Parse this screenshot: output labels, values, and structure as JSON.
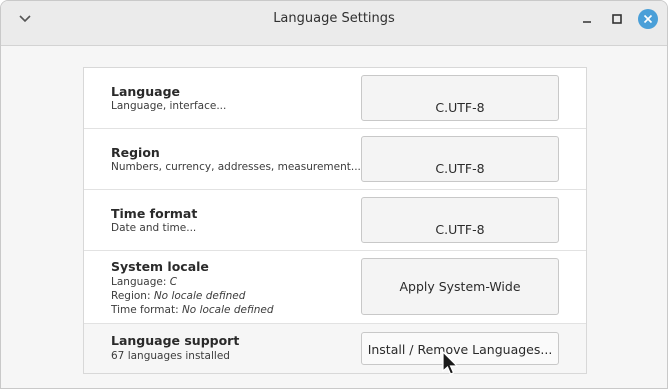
{
  "window": {
    "title": "Language Settings"
  },
  "titlebar_icons": {
    "menu": "chevron-down-icon",
    "minimize": "minimize-icon",
    "maximize": "maximize-icon",
    "close": "close-icon",
    "close_color": "#4a9fd8"
  },
  "rows": [
    {
      "title": "Language",
      "subtitle": "Language, interface...",
      "button_label": "C.UTF-8"
    },
    {
      "title": "Region",
      "subtitle": "Numbers, currency, addresses, measurement...",
      "button_label": "C.UTF-8"
    },
    {
      "title": "Time format",
      "subtitle": "Date and time...",
      "button_label": "C.UTF-8"
    }
  ],
  "system_locale": {
    "title": "System locale",
    "language_label": "Language:",
    "language_value": "C",
    "region_label": "Region:",
    "region_value": "No locale defined",
    "time_label": "Time format:",
    "time_value": "No locale defined",
    "button_label": "Apply System-Wide"
  },
  "language_support": {
    "title": "Language support",
    "subtitle": "67 languages installed",
    "button_label": "Install / Remove Languages..."
  }
}
